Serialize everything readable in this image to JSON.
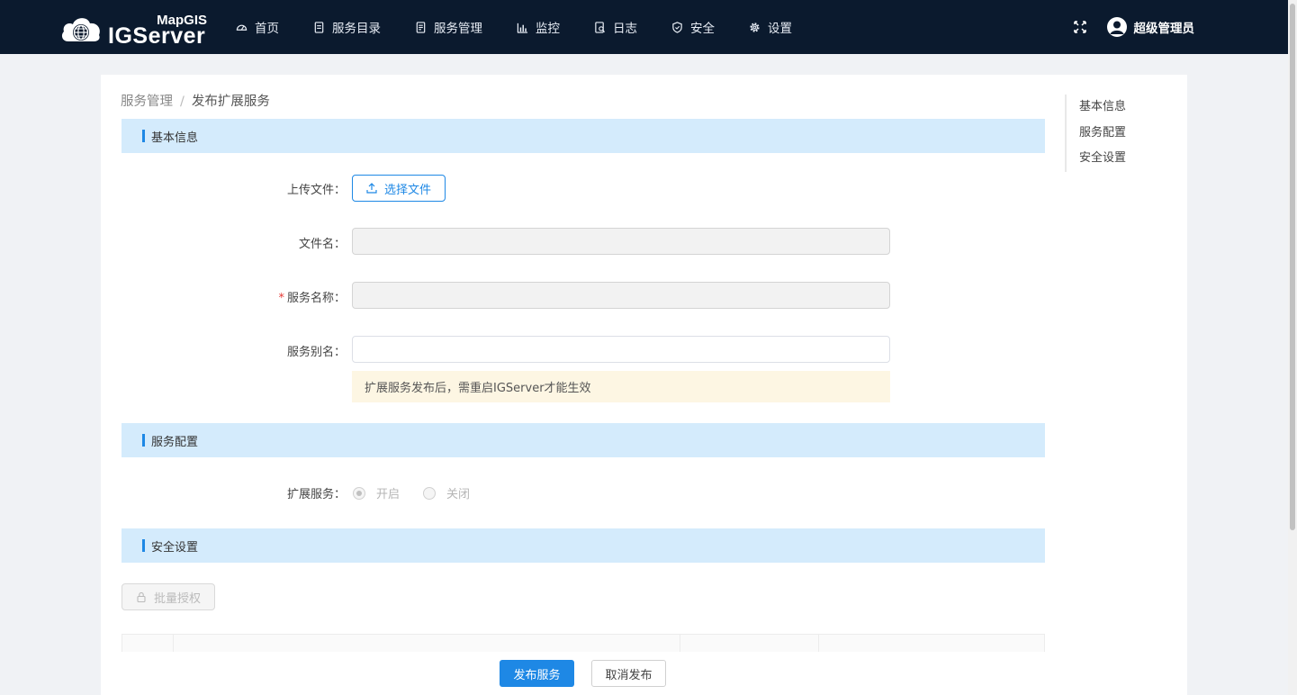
{
  "header": {
    "logo_top": "MapGIS",
    "logo_bottom": "IGServer",
    "nav": [
      {
        "label": "首页",
        "icon": "dashboard-icon"
      },
      {
        "label": "服务目录",
        "icon": "catalog-icon"
      },
      {
        "label": "服务管理",
        "icon": "document-icon"
      },
      {
        "label": "监控",
        "icon": "chart-icon"
      },
      {
        "label": "日志",
        "icon": "log-icon"
      },
      {
        "label": "安全",
        "icon": "shield-icon"
      },
      {
        "label": "设置",
        "icon": "gear-icon"
      }
    ],
    "user": "超级管理员"
  },
  "breadcrumb": {
    "parent": "服务管理",
    "separator": "/",
    "current": "发布扩展服务"
  },
  "sections": {
    "basic": "基本信息",
    "config": "服务配置",
    "security": "安全设置"
  },
  "form": {
    "upload_label": "上传文件：",
    "upload_button": "选择文件",
    "filename_label": "文件名：",
    "filename_value": "",
    "service_name_label": "服务名称：",
    "service_name_required": "*",
    "service_name_value": "",
    "alias_label": "服务别名：",
    "alias_value": "",
    "notice": "扩展服务发布后，需重启IGServer才能生效",
    "ext_label": "扩展服务：",
    "ext_on": "开启",
    "ext_off": "关闭",
    "ext_selected": "开启"
  },
  "security": {
    "batch_button": "批量授权"
  },
  "footer": {
    "publish": "发布服务",
    "cancel": "取消发布"
  },
  "anchor": {
    "items": [
      "基本信息",
      "服务配置",
      "安全设置"
    ]
  },
  "colors": {
    "header_bg": "#0b1a2e",
    "primary": "#1e88e5",
    "section_bg": "#d4ebfc",
    "notice_bg": "#fdf6e3"
  }
}
